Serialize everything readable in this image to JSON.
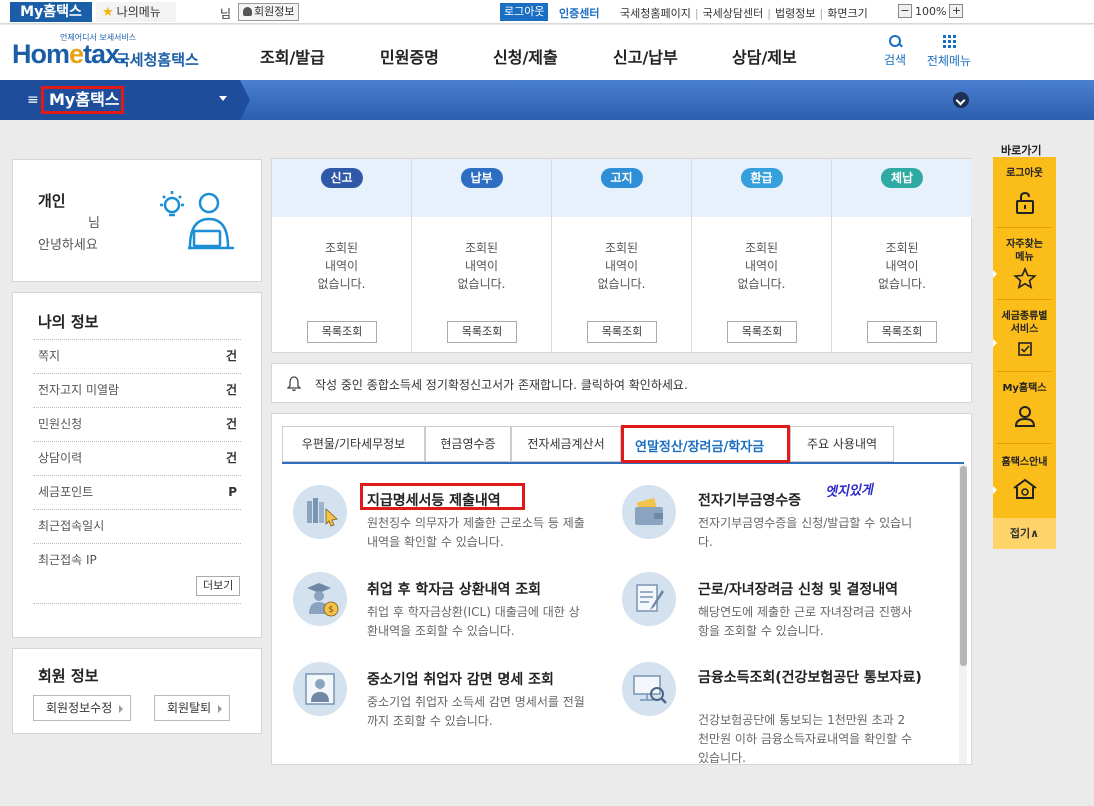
{
  "topbar": {
    "my_tab": "My홈택스",
    "my_menu": "나의메뉴",
    "nim": "님",
    "member_info": "회원정보",
    "logout": "로그아웃",
    "cert_center": "인증센터",
    "links": [
      "국세청홈페이지",
      "국세상담센터",
      "법령정보",
      "화면크기"
    ],
    "zoom_minus": "−",
    "zoom_value": "100%",
    "zoom_plus": "+"
  },
  "header": {
    "logo_small": "언제어디서 보세서비스",
    "logo_home": "Hom",
    "logo_e": "e",
    "logo_tax": "tax.",
    "logo_ko": "국세청홈택스",
    "gnb": [
      "조회/발급",
      "민원증명",
      "신청/제출",
      "신고/납부",
      "상담/제보"
    ],
    "search_label": "검색",
    "all_menu_label": "전체메뉴"
  },
  "navbar": {
    "hamburger": "≡",
    "title": "My홈택스"
  },
  "personal": {
    "title": "개인",
    "nim": "님",
    "hello": "안녕하세요"
  },
  "my_info": {
    "title": "나의 정보",
    "rows": [
      {
        "label": "쪽지",
        "value": "건"
      },
      {
        "label": "전자고지 미열람",
        "value": "건"
      },
      {
        "label": "민원신청",
        "value": "건"
      },
      {
        "label": "상담이력",
        "value": "건"
      },
      {
        "label": "세금포인트",
        "value": "P"
      },
      {
        "label": "최근접속일시",
        "value": ""
      },
      {
        "label": "최근접속 IP",
        "value": ""
      }
    ],
    "more": "더보기"
  },
  "member": {
    "title": "회원 정보",
    "edit": "회원정보수정",
    "withdraw": "회원탈퇴"
  },
  "status": [
    {
      "badge": "신고",
      "color": "#2f58a6",
      "msg": "조회된\n내역이\n없습니다.",
      "btn": "목록조회"
    },
    {
      "badge": "납부",
      "color": "#2e6ec2",
      "msg": "조회된\n내역이\n없습니다.",
      "btn": "목록조회"
    },
    {
      "badge": "고지",
      "color": "#2f8fd6",
      "msg": "조회된\n내역이\n없습니다.",
      "btn": "목록조회"
    },
    {
      "badge": "환급",
      "color": "#36a0dd",
      "msg": "조회된\n내역이\n없습니다.",
      "btn": "목록조회"
    },
    {
      "badge": "체납",
      "color": "#2eaaa3",
      "msg": "조회된\n내역이\n없습니다.",
      "btn": "목록조회"
    }
  ],
  "notice": "작성 중인 종합소득세 정기확정신고서가 존재합니다. 클릭하여 확인하세요.",
  "tabs": [
    "우편물/기타세무정보",
    "현금영수증",
    "전자세금계산서",
    "연말정산/장려금/학자금",
    "주요 사용내역"
  ],
  "services": [
    {
      "title": "지급명세서등 제출내역",
      "desc": "원천징수 의무자가 제출한 근로소득 등 제출내역을 확인할 수 있습니다."
    },
    {
      "title": "전자기부금영수증",
      "desc": "전자기부금영수증을 신청/발급할 수 있습니다."
    },
    {
      "title": "취업 후 학자금 상환내역 조회",
      "desc": "취업 후 학자금상환(ICL) 대출금에 대한 상환내역을 조회할 수 있습니다."
    },
    {
      "title": "근로/자녀장려금 신청 및 결정내역",
      "desc": "해당연도에 제출한 근로 자녀장려금 진행사항을 조회할 수 있습니다."
    },
    {
      "title": "중소기업 취업자 감면 명세 조회",
      "desc": "중소기업 취업자 소득세 감면 명세서를 전월까지 조회할 수 있습니다."
    },
    {
      "title": "금융소득조회(건강보험공단 통보자료)",
      "desc": "건강보험공단에 통보되는 1천만원 초과 2천만원 이하 금융소득자료내역을 확인할 수 있습니다."
    }
  ],
  "handwriting": "엣지있게",
  "quickbar": {
    "title": "바로가기",
    "items": [
      "로그아웃",
      "자주찾는 메뉴",
      "세금종류별 서비스",
      "My홈택스",
      "홈택스안내"
    ],
    "fold": "접기∧"
  }
}
